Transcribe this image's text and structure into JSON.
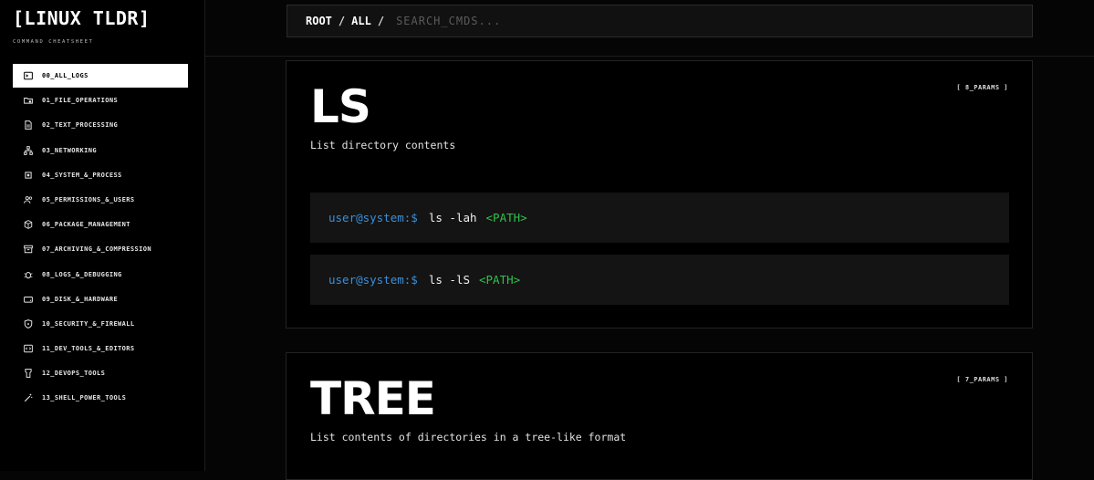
{
  "sidebar": {
    "logo": "[LINUX TLDR]",
    "subtitle": "COMMAND CHEATSHEET",
    "items": [
      {
        "label": "00_ALL_LOGS",
        "icon": "terminal-icon",
        "active": true
      },
      {
        "label": "01_FILE_OPERATIONS",
        "icon": "folder-gear-icon"
      },
      {
        "label": "02_TEXT_PROCESSING",
        "icon": "file-text-icon"
      },
      {
        "label": "03_NETWORKING",
        "icon": "network-icon"
      },
      {
        "label": "04_SYSTEM_&_PROCESS",
        "icon": "cpu-icon"
      },
      {
        "label": "05_PERMISSIONS_&_USERS",
        "icon": "users-icon"
      },
      {
        "label": "06_PACKAGE_MANAGEMENT",
        "icon": "package-icon"
      },
      {
        "label": "07_ARCHIVING_&_COMPRESSION",
        "icon": "archive-icon"
      },
      {
        "label": "08_LOGS_&_DEBUGGING",
        "icon": "bug-icon"
      },
      {
        "label": "09_DISK_&_HARDWARE",
        "icon": "hard-drive-icon"
      },
      {
        "label": "10_SECURITY_&_FIREWALL",
        "icon": "shield-icon"
      },
      {
        "label": "11_DEV_TOOLS_&_EDITORS",
        "icon": "code-icon"
      },
      {
        "label": "12_DEVOPS_TOOLS",
        "icon": "container-icon"
      },
      {
        "label": "13_SHELL_POWER_TOOLS",
        "icon": "magic-wand-icon"
      }
    ]
  },
  "header": {
    "breadcrumb_root": "ROOT",
    "breadcrumb_all": "ALL",
    "separator": "/",
    "search_placeholder": "SEARCH_CMDS...",
    "search_value": ""
  },
  "commands": [
    {
      "name": "LS",
      "params": "[ 8_PARAMS ]",
      "description": "List directory contents",
      "examples": [
        {
          "prompt": "user@system:$",
          "cmd": "ls -lah",
          "arg": "<PATH>"
        },
        {
          "prompt": "user@system:$",
          "cmd": "ls -lS",
          "arg": "<PATH>"
        }
      ]
    },
    {
      "name": "TREE",
      "params": "[ 7_PARAMS ]",
      "description": "List contents of directories in a tree-like format"
    }
  ],
  "colors": {
    "prompt": "#3b8fd9",
    "arg": "#2fc24a",
    "active_bg": "#ffffff",
    "background": "#050505"
  }
}
